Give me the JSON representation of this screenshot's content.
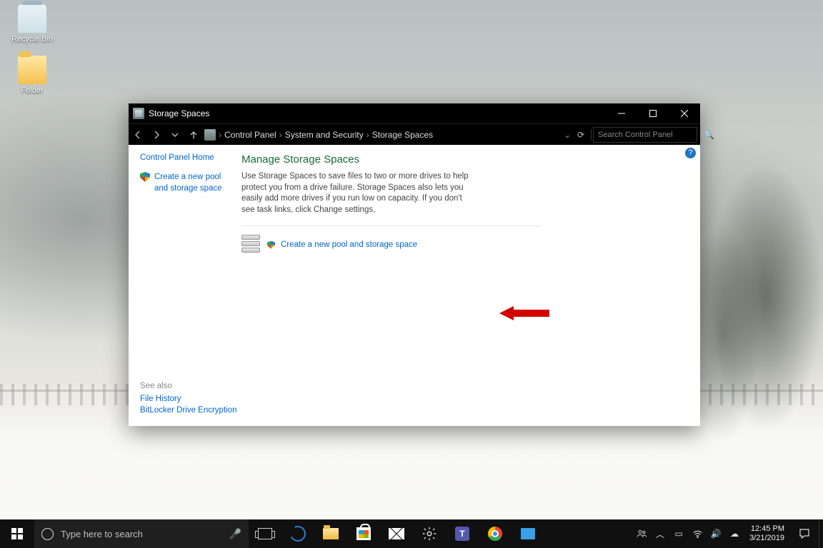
{
  "desktop": {
    "icons": [
      {
        "name": "recycle-bin",
        "label": "Recycle Bin"
      },
      {
        "name": "folder",
        "label": "Folder"
      }
    ]
  },
  "window": {
    "title": "Storage Spaces",
    "breadcrumbs": [
      "Control Panel",
      "System and Security",
      "Storage Spaces"
    ],
    "search_placeholder": "Search Control Panel",
    "sidebar": {
      "home": "Control Panel Home",
      "task": "Create a new pool and storage space",
      "see_also_header": "See also",
      "see_also": [
        "File History",
        "BitLocker Drive Encryption"
      ]
    },
    "main": {
      "heading": "Manage Storage Spaces",
      "description": "Use Storage Spaces to save files to two or more drives to help protect you from a drive failure. Storage Spaces also lets you easily add more drives if you run low on capacity. If you don't see task links, click Change settings.",
      "action_link": "Create a new pool and storage space"
    }
  },
  "taskbar": {
    "search_placeholder": "Type here to search",
    "clock": {
      "time": "12:45 PM",
      "date": "3/21/2019"
    }
  }
}
